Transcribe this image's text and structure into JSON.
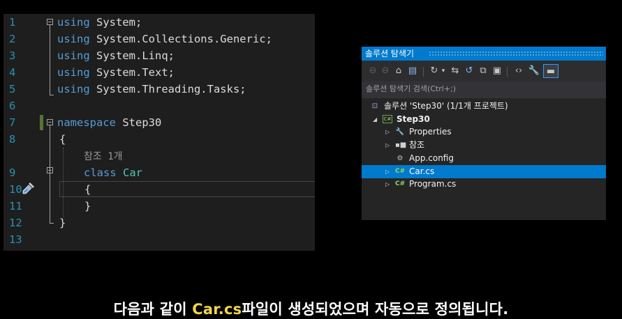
{
  "editor": {
    "lines": [
      {
        "num": "1",
        "segments": [
          {
            "c": "kw",
            "t": "using"
          },
          {
            "c": "pl",
            "t": " System;"
          }
        ]
      },
      {
        "num": "2",
        "segments": [
          {
            "c": "kw",
            "t": "using"
          },
          {
            "c": "pl",
            "t": " System.Collections.Generic;"
          }
        ]
      },
      {
        "num": "3",
        "segments": [
          {
            "c": "kw",
            "t": "using"
          },
          {
            "c": "pl",
            "t": " System.Linq;"
          }
        ]
      },
      {
        "num": "4",
        "segments": [
          {
            "c": "kw",
            "t": "using"
          },
          {
            "c": "pl",
            "t": " System.Text;"
          }
        ]
      },
      {
        "num": "5",
        "segments": [
          {
            "c": "kw",
            "t": "using"
          },
          {
            "c": "pl",
            "t": " System.Threading.Tasks;"
          }
        ]
      },
      {
        "num": "6",
        "segments": []
      },
      {
        "num": "7",
        "segments": [
          {
            "c": "kw",
            "t": "namespace"
          },
          {
            "c": "pl",
            "t": " Step30"
          }
        ]
      },
      {
        "num": "8",
        "segments": [
          {
            "c": "pl",
            "t": "{"
          }
        ]
      },
      {
        "num": "",
        "segments": [
          {
            "c": "ref",
            "t": "참조 1개"
          }
        ]
      },
      {
        "num": "9",
        "segments": [
          {
            "c": "kw",
            "t": "class"
          },
          {
            "c": "pl",
            "t": " "
          },
          {
            "c": "ty",
            "t": "Car"
          }
        ]
      },
      {
        "num": "10",
        "segments": [
          {
            "c": "pl",
            "t": "{"
          }
        ]
      },
      {
        "num": "11",
        "segments": [
          {
            "c": "pl",
            "t": "}"
          }
        ]
      },
      {
        "num": "12",
        "segments": [
          {
            "c": "pl",
            "t": "}"
          }
        ]
      },
      {
        "num": "13",
        "segments": []
      }
    ]
  },
  "solution_explorer": {
    "title": "솔루션 탐색기",
    "search_placeholder": "솔루션 탐색기 검색(Ctrl+;)",
    "toolbar_icons": [
      "back-icon",
      "forward-icon",
      "home-icon",
      "switch-views-icon",
      "pending-changes-icon",
      "sync-icon",
      "refresh-icon",
      "collapse-all-icon",
      "show-all-files-icon",
      "view-code-icon",
      "properties-icon",
      "preview-icon"
    ],
    "tree": [
      {
        "label": "솔루션 'Step30' (1/1개 프로젝트)",
        "icon": "solution-icon",
        "expander": "",
        "bold": false,
        "selected": false
      },
      {
        "label": "Step30",
        "icon": "csharp-project-icon",
        "expander": "◢",
        "bold": true,
        "selected": false
      },
      {
        "label": "Properties",
        "icon": "wrench-icon",
        "expander": "▷",
        "bold": false,
        "selected": false
      },
      {
        "label": "참조",
        "icon": "references-icon",
        "expander": "▷",
        "bold": false,
        "selected": false
      },
      {
        "label": "App.config",
        "icon": "config-file-icon",
        "expander": "",
        "bold": false,
        "selected": false
      },
      {
        "label": "Car.cs",
        "icon": "csharp-file-icon",
        "expander": "▷",
        "bold": false,
        "selected": true
      },
      {
        "label": "Program.cs",
        "icon": "csharp-file-icon",
        "expander": "▷",
        "bold": false,
        "selected": false
      }
    ]
  },
  "subtitle": {
    "before": "다음과 같이 ",
    "highlight": "Car.cs",
    "after": "파일이 생성되었으며 자동으로 정의됩니다."
  },
  "colors": {
    "keyword": "#569cd6",
    "type": "#4ec9b0",
    "line_number": "#2b91af",
    "vs_blue": "#007acc",
    "subtitle_highlight": "#f2d64b"
  }
}
